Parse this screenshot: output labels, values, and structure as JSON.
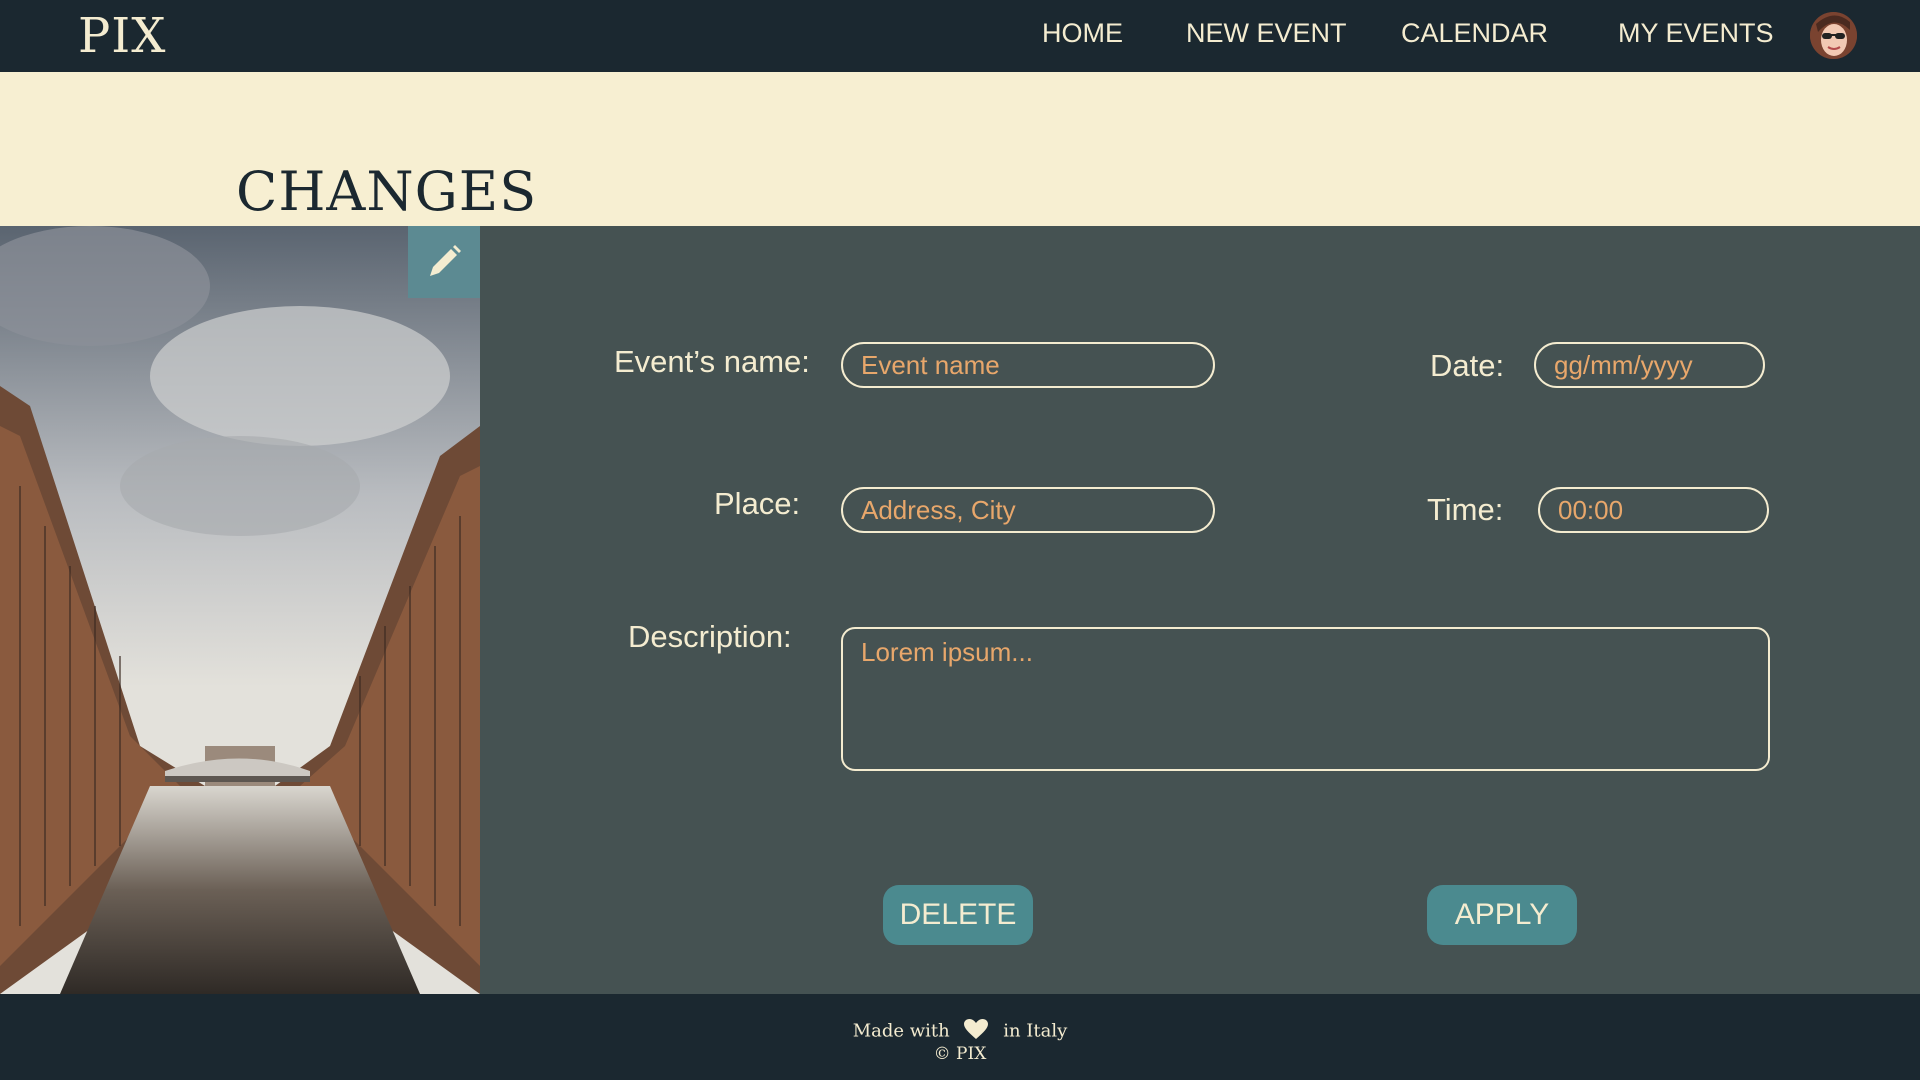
{
  "nav": {
    "logo": "PIX",
    "links": [
      "HOME",
      "NEW EVENT",
      "CALENDAR",
      "MY EVENTS"
    ],
    "avatar_icon": "user-avatar"
  },
  "banner": {
    "title": "CHANGES"
  },
  "photo": {
    "edit_icon": "pencil-icon"
  },
  "form": {
    "event_name": {
      "label": "Event’s name:",
      "placeholder": "Event name"
    },
    "date": {
      "label": "Date:",
      "placeholder": "gg/mm/yyyy"
    },
    "place": {
      "label": "Place:",
      "placeholder": "Address, City"
    },
    "time": {
      "label": "Time:",
      "placeholder": "00:00"
    },
    "description": {
      "label": "Description:",
      "placeholder": "Lorem ipsum..."
    },
    "delete_label": "DELETE",
    "apply_label": "APPLY"
  },
  "footer": {
    "made_with": "Made with",
    "in_italy": "in Italy",
    "copyright": "© PIX",
    "heart_icon": "heart-icon"
  },
  "colors": {
    "nav_bg": "#1b2830",
    "banner_bg": "#f7efd2",
    "panel_bg": "#455252",
    "accent": "#4b8a8f",
    "text_light": "#f4ecd0",
    "placeholder": "#e8a76b"
  }
}
